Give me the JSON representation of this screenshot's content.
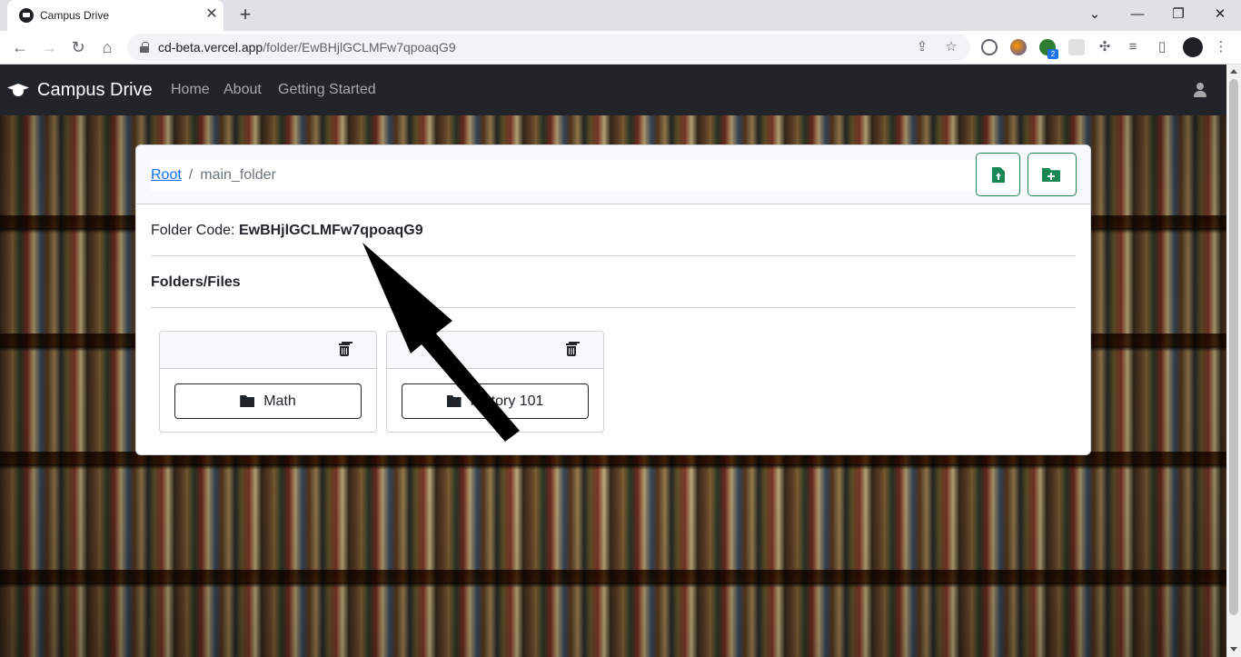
{
  "browser": {
    "tab_title": "Campus Drive",
    "url_host": "cd-beta.vercel.app",
    "url_path": "/folder/EwBHjlGCLMFw7qpoaqG9",
    "extension_badge": "2"
  },
  "navbar": {
    "brand": "Campus Drive",
    "links": [
      "Home",
      "About",
      "Getting Started"
    ]
  },
  "breadcrumb": {
    "root": "Root",
    "separator": "/",
    "current": "main_folder"
  },
  "folder_code": {
    "label": "Folder Code:",
    "value": "EwBHjlGCLMFw7qpoaqG9"
  },
  "section_title": "Folders/Files",
  "items": [
    {
      "name": "Math"
    },
    {
      "name": "History 101"
    }
  ],
  "colors": {
    "navbar_bg": "#212529",
    "accent_green": "#198754",
    "link_blue": "#0d6efd"
  }
}
